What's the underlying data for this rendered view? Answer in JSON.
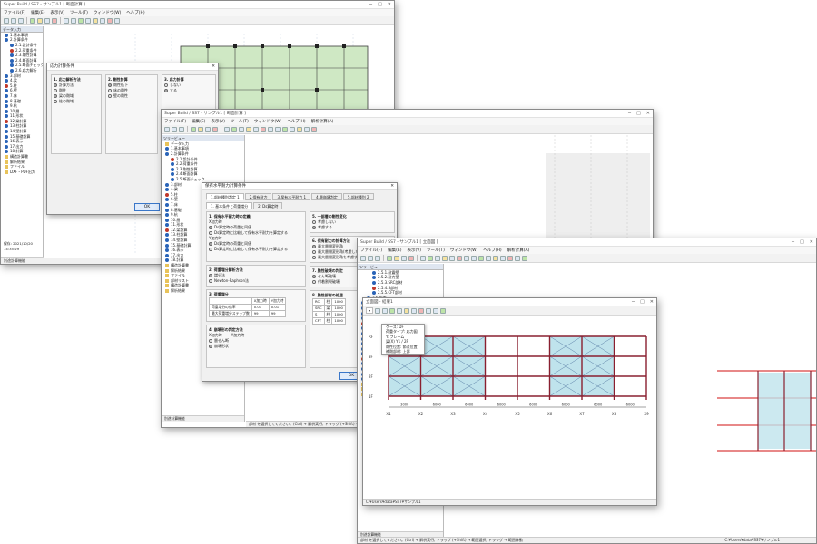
{
  "win1": {
    "title": "Super Build / SS7 - サンプル1 [ 断面計算 ]",
    "menu": [
      "ファイル(F)",
      "編集(E)",
      "表示(V)",
      "ツール(T)",
      "ウィンドウ(W)",
      "ヘルプ(H)"
    ],
    "tree_title": "データ入力",
    "tree_items": [
      "1.基本事項",
      "2.計算条件",
      "2.1.設計条件",
      "2.2.荷重条件",
      "2.3.剛性計算",
      "2.4.断面計算",
      "2.5.断面チェック",
      "2.6.応力解析",
      "3.部材",
      "4.梁",
      "5.柱",
      "6.壁",
      "7.床",
      "8.基礎",
      "9.杭",
      "10.層",
      "11.形状",
      "12.梁計算",
      "13.柱計算",
      "14.壁計算",
      "15.基礎計算",
      "16.表示",
      "17.出力",
      "18.計算",
      "構造計算書",
      "解析結果",
      "ファイル",
      "DXF・PDF出力"
    ],
    "status_time": "保存: 2021/10/20 14:35:29",
    "status_bottom": "別途計算機能",
    "dialog": {
      "title": "応力計算条件",
      "group1": "1. 応力解析方法",
      "g1_items": [
        "計算方法",
        "剛性",
        "梁の剛域",
        "柱の剛域"
      ],
      "group2": "2. 剛性計算",
      "g2_items": [
        "剛性低下",
        "床の剛性",
        "壁の剛性"
      ],
      "group3": "3. 応力計算",
      "g3_items": [
        "しない",
        "する"
      ],
      "ok": "OK",
      "cancel": "キャンセル"
    }
  },
  "win2": {
    "title": "Super Build / SS7 - サンプル1 [ 断面計算 ]",
    "menu": [
      "ファイル(F)",
      "編集(E)",
      "表示(V)",
      "ツール(T)",
      "ウィンドウ(W)",
      "ヘルプ(H)",
      "解析計算(A)"
    ],
    "tree_title": "ツリービュー",
    "tree_items": [
      "データ入力",
      "1.基本事項",
      "2.計算条件",
      "2.1.設計条件",
      "2.2.荷重条件",
      "2.3.剛性計算",
      "2.4.断面計算",
      "2.5.断面チェック",
      "3.部材",
      "4.梁",
      "5.柱",
      "6.壁",
      "7.床",
      "8.基礎",
      "9.杭",
      "10.層",
      "11.形状",
      "12.梁計算",
      "13.柱計算",
      "14.壁計算",
      "15.基礎計算",
      "16.表示",
      "17.出力",
      "18.計算",
      "構造計算書",
      "解析結果",
      "ファイル",
      "部材リスト",
      "構造計算書",
      "解析結果"
    ],
    "status": "部材 を選択してください。(Ctrl) + 解析実行, ドラッグ (+Shift) → 範囲選択, ドラッグ → 範囲移動",
    "status_bottom": "別途計算機能",
    "dialog": {
      "title": "保有水平耐力計算条件",
      "tabs": [
        "1.部材種別判定 1",
        "2.保有耐力",
        "3.保有水平耐力 1",
        "4.層崩壊判定",
        "5.部材種別 2"
      ],
      "sub_tabs": [
        "1. 基本条件と荷重増分",
        "2. Ds算定時"
      ],
      "sec1": "1. 保有水平耐力時の定義",
      "sec1_items": [
        "X加力時",
        "Ds算定時の荷重と同値",
        "Ds算定時に比較して保有水平耐力を算定する",
        "Y加力時",
        "Ds算定時の荷重と同値",
        "Ds算定時に比較して保有水平耐力を算定する"
      ],
      "sec2": "2. 荷重増分解析方法",
      "sec2_items": [
        "増分法",
        "Newton-Raphson法"
      ],
      "sec3": "3. 荷重増分",
      "sec3_head": [
        "X加力時",
        "Y加力時"
      ],
      "sec3_rows": [
        [
          "荷重増分の倍率",
          "0.01",
          "0.01"
        ],
        [
          "最大荷重増分ステップ数",
          "99",
          "99"
        ]
      ],
      "sec4": "4. 崩壊形の判定方法",
      "sec4_items": [
        "X加力時",
        "Y加力時",
        "層せん断",
        "崩壊形状"
      ],
      "right1": "5. 一部層の剛性変化",
      "right1_items": [
        "考慮しない",
        "考慮する"
      ],
      "right2": "6. 保有耐力の計算方法",
      "right2_items": [
        "最大層間変形角",
        "最大層間変形角(考慮しない)",
        "最大層間変形角を考慮する"
      ],
      "right3": "7. 脆性破壊の判定",
      "right3_items": [
        "せん断破壊",
        "付着割裂破壊"
      ],
      "right4": "8. 脆性部材の処理",
      "table_rows": [
        [
          "RC",
          "柱",
          "1000"
        ],
        [
          "SRC",
          "梁",
          "1000"
        ],
        [
          "S",
          "柱",
          "1000"
        ],
        [
          "CFT",
          "柱",
          "1000"
        ]
      ],
      "ok": "OK",
      "cancel": "キャンセル"
    }
  },
  "win3": {
    "title": "Super Build / SS7 - サンプル1 [ 立面図 ]",
    "menu": [
      "ファイル(F)",
      "編集(E)",
      "表示(V)",
      "ツール(T)",
      "ウィンドウ(W)",
      "ヘルプ(H)",
      "解析計算(A)"
    ],
    "tree_title": "ツリービュー",
    "tree_items": [
      "2.5.1.耐震壁",
      "2.5.2.耐力壁",
      "2.5.3.SRC部材",
      "2.5.4.S部材",
      "2.5.5.CFT部材",
      "2.6.応力",
      "3.荷重",
      "4.梁",
      "5.柱",
      "6.壁",
      "7.床",
      "8.基礎",
      "9.杭",
      "10.層",
      "11.形状",
      "12.梁計算",
      "13.柱計算",
      "14.壁計算",
      "15.基礎計算",
      "16.表示",
      "17.出力",
      "18.計算",
      "構造計算書",
      "解析結果",
      "ファイル"
    ],
    "inner": {
      "title": "立面図 - 結果1",
      "popup": [
        "ケース: DF",
        "荷重タイプ: 応力図",
        "Y: フレーム",
        "梁(X) Y1 / 2F",
        "剛性位置: 節点位置",
        "補剛部材: 上部"
      ],
      "grid_x": [
        "X1",
        "X2",
        "X3",
        "X4",
        "X5",
        "X6",
        "X7",
        "X8",
        "X9"
      ],
      "dims": [
        "3000",
        "6000",
        "6000",
        "6000",
        "6000",
        "6000",
        "6000",
        "6000"
      ],
      "levels": [
        "RF",
        "3F",
        "2F",
        "1F"
      ],
      "status": "C:¥Users¥data¥SS7¥サンプル1"
    },
    "status": "部材 を選択してください。(Ctrl) + 解析実行, ドラッグ (+Shift) → 範囲選択, ドラッグ → 範囲移動",
    "status_right": "C:¥Users¥data¥SS7¥サンプル1",
    "status_bottom": "別途計算機能"
  }
}
